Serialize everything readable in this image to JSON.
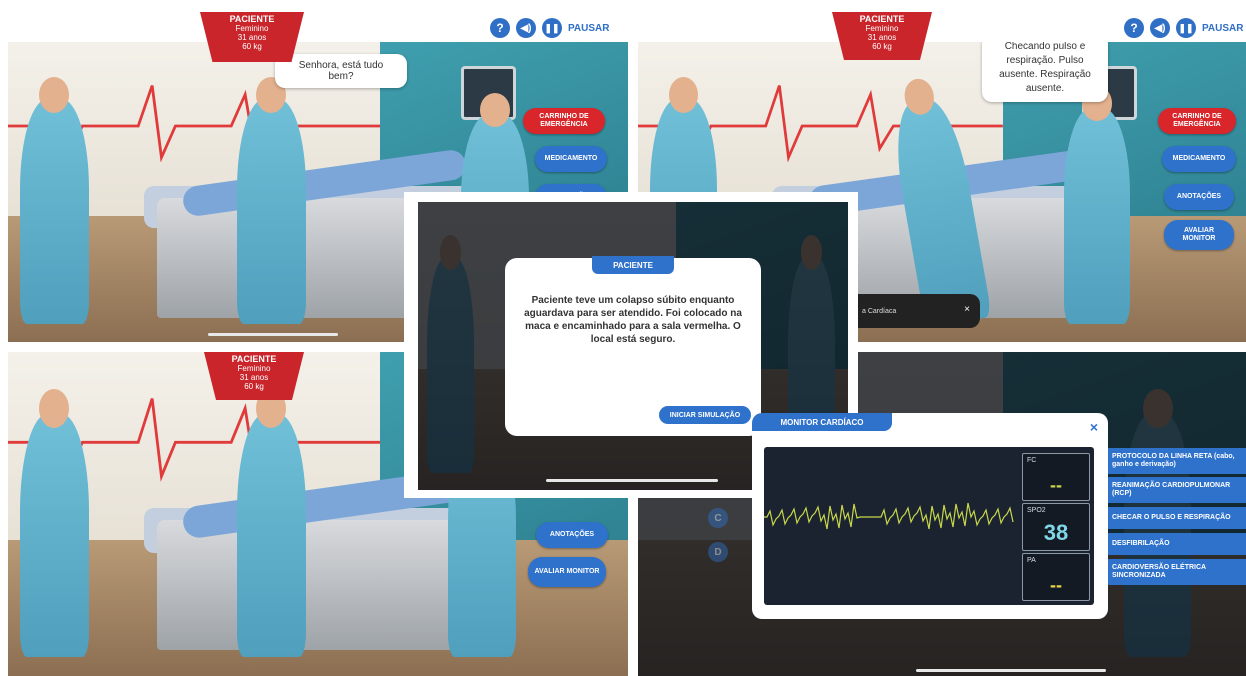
{
  "patient_tag": {
    "title": "PACIENTE",
    "sex": "Feminino",
    "age": "31 anos",
    "weight": "60 kg"
  },
  "controls": {
    "help_icon": "question-icon",
    "sound_icon": "speaker-icon",
    "pause_icon": "pause-icon",
    "pause_label": "PAUSAR"
  },
  "menu": {
    "cart": "CARRINHO DE EMERGÊNCIA",
    "medication": "MEDICAMENTO",
    "notes": "ANOTAÇÕES",
    "monitor": "AVALIAR MONITOR"
  },
  "panel_tl": {
    "speech": "Senhora, está tudo bem?"
  },
  "panel_tr": {
    "speech": "Checando pulso e respiração. Pulso ausente. Respiração ausente.",
    "toast_text": "a Cardíaca",
    "toast_close": "×"
  },
  "intro_modal": {
    "tab": "PACIENTE",
    "text": "Paciente teve um colapso súbito enquanto aguardava para ser atendido. Foi colocado na maca e encaminhado para a sala vermelha. O local está seguro.",
    "start_button": "INICIAR SIMULAÇÃO"
  },
  "monitor_modal": {
    "tab": "MONITOR CARDÍACO",
    "close": "×",
    "fc_label": "FC",
    "fc_value": "--",
    "spo2_label": "SPO2",
    "spo2_value": "38",
    "pa_label": "PA",
    "pa_value": "--",
    "colors": {
      "fc": "#c8d84a",
      "spo2": "#7fd6e6",
      "pa": "#e6d84a",
      "trace": "#c8d84a"
    }
  },
  "protocol_options": [
    "PROTOCOLO DA LINHA RETA (cabo, ganho e derivação)",
    "REANIMAÇÃO CARDIOPULMONAR (RCP)",
    "CHECAR O PULSO E RESPIRAÇÃO",
    "DESFIBRILAÇÃO",
    "CARDIOVERSÃO ELÉTRICA SINCRONIZADA"
  ],
  "letters": [
    "C",
    "D"
  ]
}
